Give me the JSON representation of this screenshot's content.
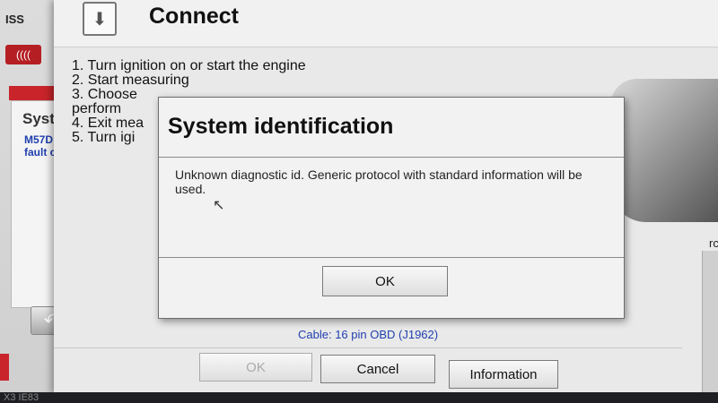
{
  "left_panel": {
    "app_abbrev": "ISS",
    "brand_logo_text": "((((",
    "side_title": "Syst",
    "side_list": [
      "M57D",
      "fault c"
    ],
    "back_icon": "back-arrow-icon"
  },
  "connect": {
    "title": "Connect",
    "icon": "connect-device-icon",
    "instructions": [
      "1. Turn ignition on or start the engine",
      "2. Start measuring",
      "3. Choose",
      "perform",
      "4. Exit mea",
      "5. Turn igi"
    ],
    "right_edge_text": "rc",
    "cable_info": "Cable: 16 pin OBD (J1962)",
    "buttons": {
      "ok": "OK",
      "cancel": "Cancel",
      "information": "Information"
    }
  },
  "dialog": {
    "title": "System identification",
    "message": "Unknown diagnostic id. Generic protocol with standard information will be used.",
    "ok_label": "OK"
  },
  "status_bar": {
    "text": "X3 IE83"
  },
  "colors": {
    "accent_red": "#c8242a",
    "link_blue": "#1f3fae"
  }
}
